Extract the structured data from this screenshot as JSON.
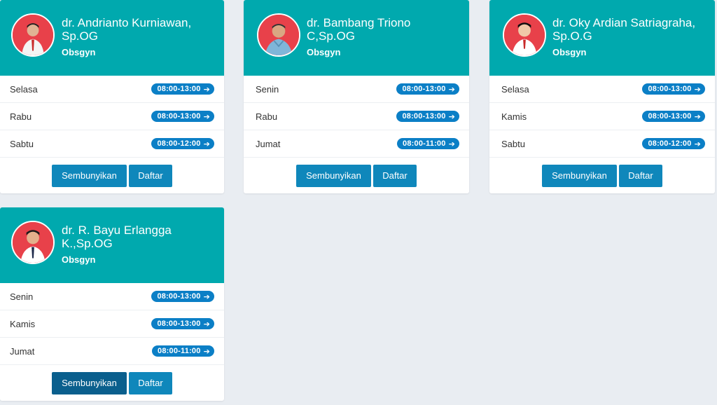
{
  "doctors": [
    {
      "name": "dr. Andrianto Kurniawan, Sp.OG",
      "specialty": "Obsgyn",
      "schedule": [
        {
          "day": "Selasa",
          "time": "08:00-13:00"
        },
        {
          "day": "Rabu",
          "time": "08:00-13:00"
        },
        {
          "day": "Sabtu",
          "time": "08:00-12:00"
        }
      ],
      "hide_label": "Sembunyikan",
      "register_label": "Daftar"
    },
    {
      "name": "dr. Bambang Triono C,Sp.OG",
      "specialty": "Obsgyn",
      "schedule": [
        {
          "day": "Senin",
          "time": "08:00-13:00"
        },
        {
          "day": "Rabu",
          "time": "08:00-13:00"
        },
        {
          "day": "Jumat",
          "time": "08:00-11:00"
        }
      ],
      "hide_label": "Sembunyikan",
      "register_label": "Daftar"
    },
    {
      "name": "dr. Oky Ardian Satriagraha, Sp.O.G",
      "specialty": "Obsgyn",
      "schedule": [
        {
          "day": "Selasa",
          "time": "08:00-13:00"
        },
        {
          "day": "Kamis",
          "time": "08:00-13:00"
        },
        {
          "day": "Sabtu",
          "time": "08:00-12:00"
        }
      ],
      "hide_label": "Sembunyikan",
      "register_label": "Daftar"
    },
    {
      "name": "dr. R. Bayu Erlangga K.,Sp.OG",
      "specialty": "Obsgyn",
      "schedule": [
        {
          "day": "Senin",
          "time": "08:00-13:00"
        },
        {
          "day": "Kamis",
          "time": "08:00-13:00"
        },
        {
          "day": "Jumat",
          "time": "08:00-11:00"
        }
      ],
      "hide_label": "Sembunyikan",
      "register_label": "Daftar"
    }
  ],
  "icons": {
    "time_arrow": "arrow-right-icon",
    "avatar": "doctor-photo"
  },
  "colors": {
    "header": "#00a9ae",
    "badge": "#0b7fc6",
    "button": "#0f87bb",
    "button_active": "#0a5f8d",
    "background": "#e9edf2"
  }
}
